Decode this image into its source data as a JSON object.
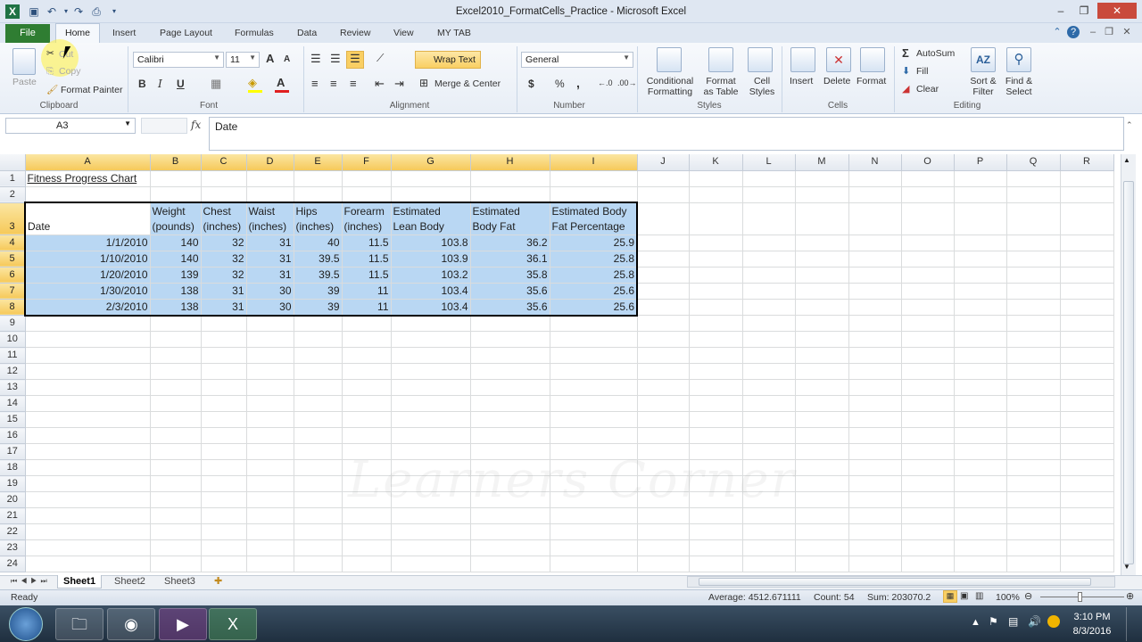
{
  "window": {
    "title": "Excel2010_FormatCells_Practice - Microsoft Excel"
  },
  "tabs": [
    {
      "label": "File"
    },
    {
      "label": "Home"
    },
    {
      "label": "Insert"
    },
    {
      "label": "Page Layout"
    },
    {
      "label": "Formulas"
    },
    {
      "label": "Data"
    },
    {
      "label": "Review"
    },
    {
      "label": "View"
    },
    {
      "label": "MY TAB"
    }
  ],
  "ribbon": {
    "clipboard": {
      "paste": "Paste",
      "cut": "Cut",
      "copy": "Copy",
      "format_painter": "Format Painter",
      "label": "Clipboard"
    },
    "font": {
      "name": "Calibri",
      "size": "11",
      "label": "Font",
      "grow": "A",
      "shrink": "A",
      "bold": "B",
      "italic": "I",
      "underline": "U"
    },
    "alignment": {
      "wrap_text": "Wrap Text",
      "merge_center": "Merge & Center",
      "label": "Alignment"
    },
    "number": {
      "format": "General",
      "currency": "$",
      "percent": "%",
      "comma": ",",
      "label": "Number"
    },
    "styles": {
      "conditional": "Conditional",
      "conditional2": "Formatting",
      "format_as": "Format",
      "format_as2": "as Table",
      "cell": "Cell",
      "cell2": "Styles",
      "label": "Styles"
    },
    "cells": {
      "insert": "Insert",
      "delete": "Delete",
      "format": "Format",
      "label": "Cells"
    },
    "editing": {
      "autosum": "AutoSum",
      "fill": "Fill",
      "clear": "Clear",
      "sort": "Sort &",
      "sort2": "Filter",
      "find": "Find &",
      "find2": "Select",
      "label": "Editing",
      "sigma": "Σ"
    }
  },
  "formula_bar": {
    "name_box": "A3",
    "fx": "fx",
    "value": "Date"
  },
  "columns": [
    "A",
    "B",
    "C",
    "D",
    "E",
    "F",
    "G",
    "H",
    "I",
    "J",
    "K",
    "L",
    "M",
    "N",
    "O",
    "P",
    "Q",
    "R"
  ],
  "sheet": {
    "title": "Fitness Progress Chart",
    "headers": [
      {
        "l1": "",
        "l2": "Date"
      },
      {
        "l1": "Weight",
        "l2": "(pounds)"
      },
      {
        "l1": "Chest",
        "l2": "(inches)"
      },
      {
        "l1": "Waist",
        "l2": "(inches)"
      },
      {
        "l1": "Hips",
        "l2": "(inches)"
      },
      {
        "l1": "Forearm",
        "l2": "(inches)"
      },
      {
        "l1": "Estimated",
        "l2": "Lean Body"
      },
      {
        "l1": "Estimated",
        "l2": "Body Fat"
      },
      {
        "l1": "Estimated Body",
        "l2": "Fat Percentage"
      }
    ],
    "rows": [
      [
        "1/1/2010",
        "140",
        "32",
        "31",
        "40",
        "11.5",
        "103.8",
        "36.2",
        "25.9"
      ],
      [
        "1/10/2010",
        "140",
        "32",
        "31",
        "39.5",
        "11.5",
        "103.9",
        "36.1",
        "25.8"
      ],
      [
        "1/20/2010",
        "139",
        "32",
        "31",
        "39.5",
        "11.5",
        "103.2",
        "35.8",
        "25.8"
      ],
      [
        "1/30/2010",
        "138",
        "31",
        "30",
        "39",
        "11",
        "103.4",
        "35.6",
        "25.6"
      ],
      [
        "2/3/2010",
        "138",
        "31",
        "30",
        "39",
        "11",
        "103.4",
        "35.6",
        "25.6"
      ]
    ]
  },
  "sheet_tabs": [
    "Sheet1",
    "Sheet2",
    "Sheet3"
  ],
  "status": {
    "ready": "Ready",
    "average": "Average: 4512.671111",
    "count": "Count: 54",
    "sum": "Sum: 203070.2",
    "zoom": "100%"
  },
  "taskbar": {
    "time": "3:10 PM",
    "date": "8/3/2016"
  },
  "watermark": "Learners Corner",
  "colors": {
    "file_tab": "#2f7d32",
    "selection": "#b9d7f3",
    "header_selected": "#f6c95a"
  }
}
